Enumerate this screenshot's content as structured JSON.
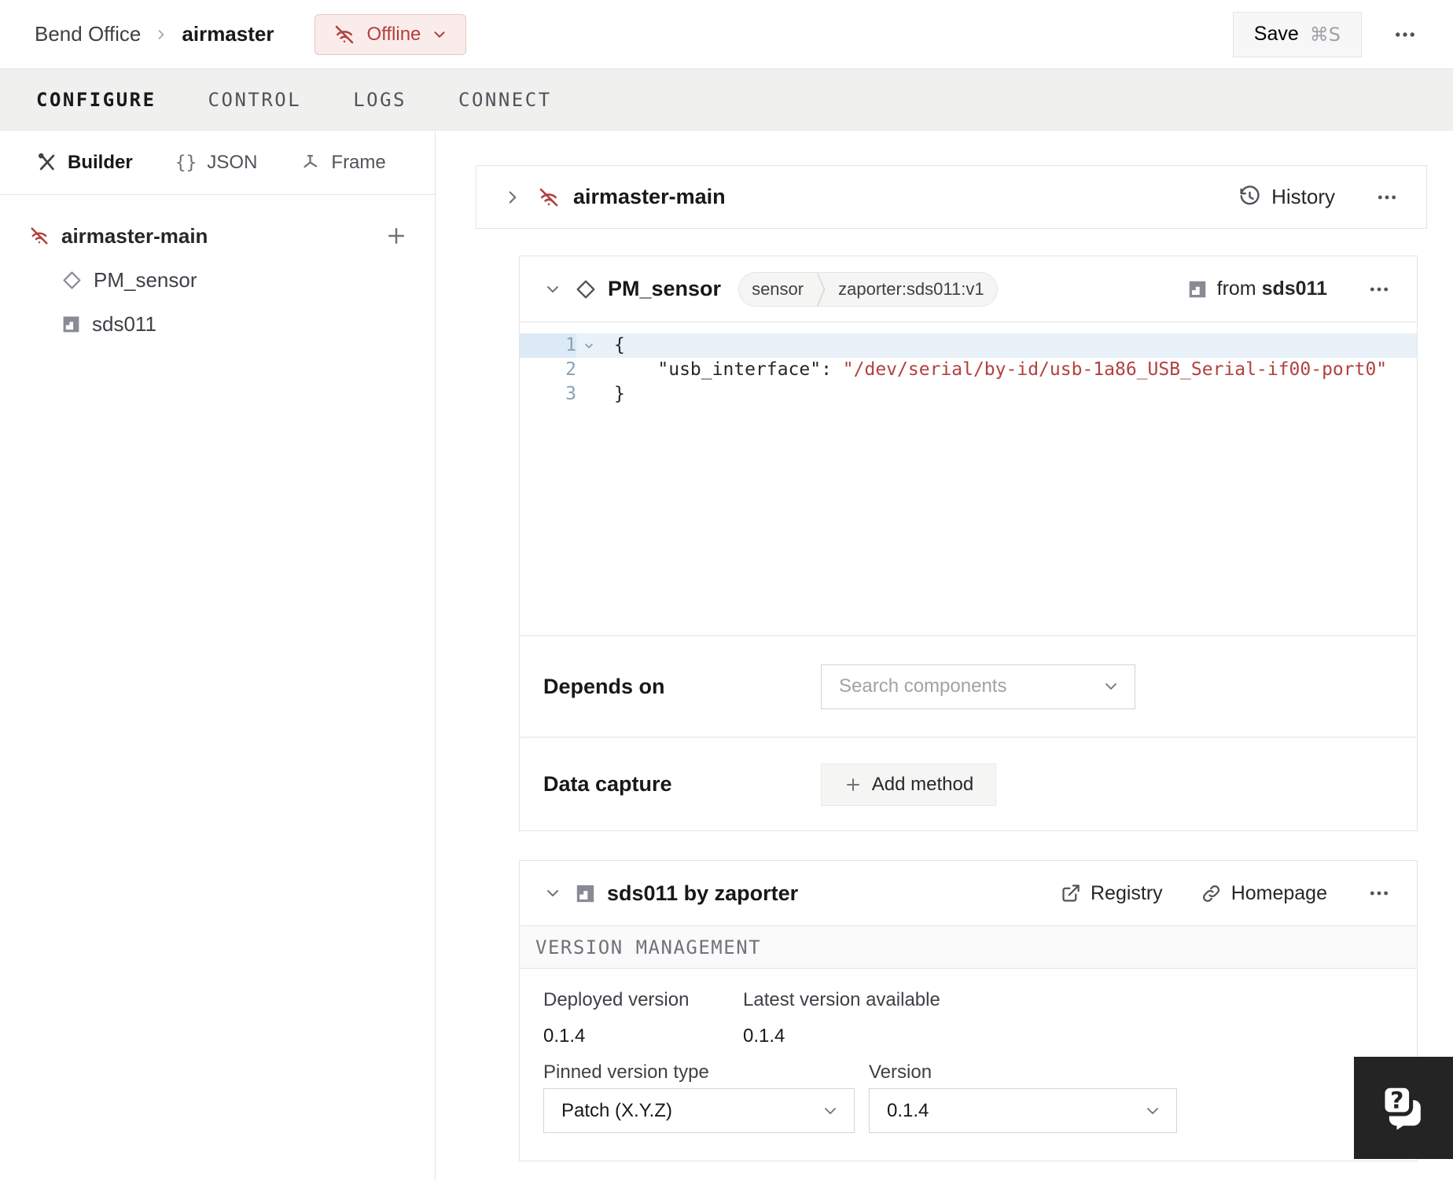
{
  "topbar": {
    "breadcrumb": {
      "org": "Bend Office",
      "machine": "airmaster"
    },
    "status": {
      "label": "Offline"
    },
    "save": {
      "label": "Save",
      "shortcut": "⌘S"
    }
  },
  "tabs": [
    {
      "label": "CONFIGURE",
      "active": true
    },
    {
      "label": "CONTROL",
      "active": false
    },
    {
      "label": "LOGS",
      "active": false
    },
    {
      "label": "CONNECT",
      "active": false
    }
  ],
  "sidebar": {
    "modes": [
      {
        "label": "Builder",
        "active": true
      },
      {
        "label": "JSON",
        "active": false
      },
      {
        "label": "Frame",
        "active": false
      }
    ],
    "json_glyph": "{}",
    "tree": {
      "root": "airmaster-main",
      "children": [
        {
          "label": "PM_sensor"
        },
        {
          "label": "sds011"
        }
      ]
    }
  },
  "main": {
    "machine_card": {
      "title": "airmaster-main",
      "history_label": "History"
    },
    "component_card": {
      "title": "PM_sensor",
      "chip_type": "sensor",
      "chip_model": "zaporter:sds011:v1",
      "from_prefix": "from",
      "from_module": "sds011",
      "editor": {
        "line1_num": "1",
        "line1_code": "{",
        "line2_num": "2",
        "line2_key": "    \"usb_interface\": ",
        "line2_value": "\"/dev/serial/by-id/usb-1a86_USB_Serial-if00-port0\"",
        "line3_num": "3",
        "line3_code": "}"
      },
      "depends_on": {
        "label": "Depends on",
        "placeholder": "Search components"
      },
      "data_capture": {
        "label": "Data capture",
        "button_label": "Add method"
      }
    },
    "module_card": {
      "title": "sds011 by zaporter",
      "registry_label": "Registry",
      "homepage_label": "Homepage",
      "section_title": "VERSION MANAGEMENT",
      "deployed_label": "Deployed version",
      "deployed_value": "0.1.4",
      "latest_label": "Latest version available",
      "latest_value": "0.1.4",
      "pin_label": "Pinned version type",
      "pin_value": "Patch (X.Y.Z)",
      "version_label": "Version",
      "version_value": "0.1.4"
    }
  },
  "colors": {
    "status_red": "#b0413e",
    "status_bg": "#faeceb",
    "status_border": "#eac5c0",
    "editor_highlight": "#e9f1f9",
    "code_string": "#b0413e",
    "help_bg": "#242424"
  }
}
